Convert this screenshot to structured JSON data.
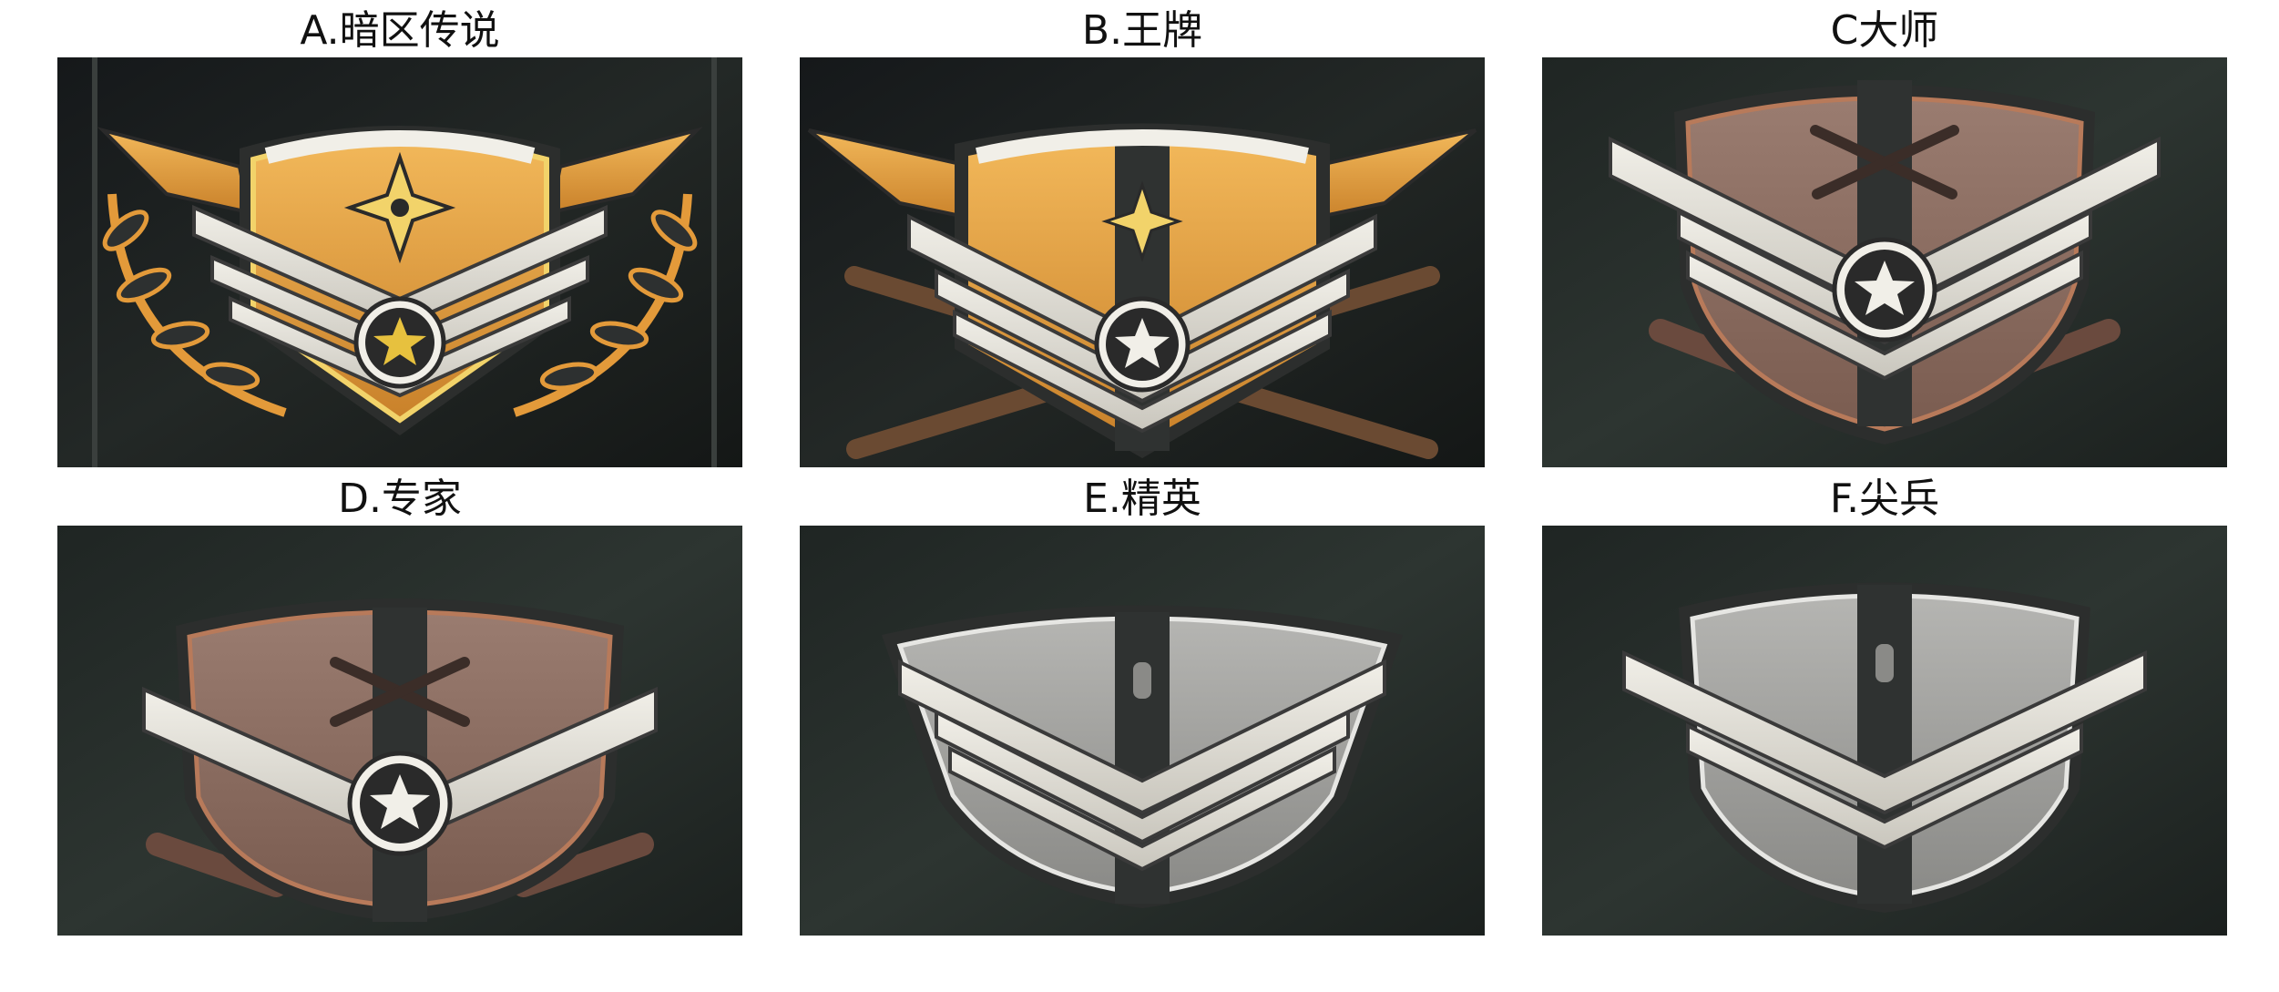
{
  "figure": {
    "panels": [
      {
        "label": "A.暗区传说",
        "insignia": "legend-rank-insignia-icon",
        "tier_color": "#e39a3a"
      },
      {
        "label": "B.王牌",
        "insignia": "ace-rank-insignia-icon",
        "tier_color": "#d8913c"
      },
      {
        "label": "C大师",
        "insignia": "master-rank-insignia-icon",
        "tier_color": "#8e7065"
      },
      {
        "label": "D.专家",
        "insignia": "expert-rank-insignia-icon",
        "tier_color": "#85695f"
      },
      {
        "label": "E.精英",
        "insignia": "elite-rank-insignia-icon",
        "tier_color": "#9a9a98"
      },
      {
        "label": "F.尖兵",
        "insignia": "vanguard-rank-insignia-icon",
        "tier_color": "#a3a3a1"
      }
    ]
  }
}
